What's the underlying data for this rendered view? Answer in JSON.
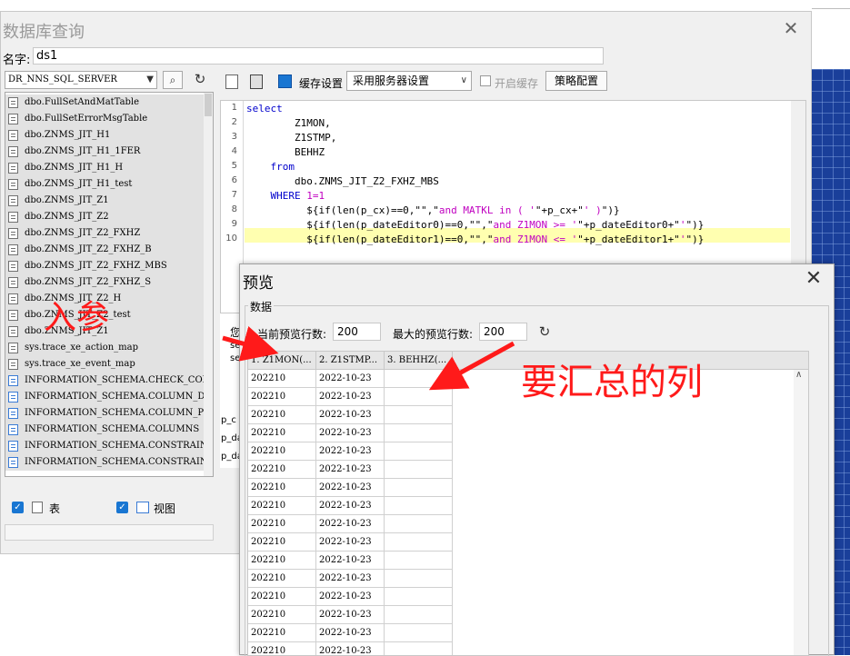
{
  "db_query": {
    "title": "数据库查询",
    "name_label": "名字:",
    "name_value": "ds1",
    "datasource": "DR_NNS_SQL_SERVER",
    "tables": [
      "dbo.FullSetAndMatTable",
      "dbo.FullSetErrorMsgTable",
      "dbo.ZNMS_JIT_H1",
      "dbo.ZNMS_JIT_H1_1FER",
      "dbo.ZNMS_JIT_H1_H",
      "dbo.ZNMS_JIT_H1_test",
      "dbo.ZNMS_JIT_Z1",
      "dbo.ZNMS_JIT_Z2",
      "dbo.ZNMS_JIT_Z2_FXHZ",
      "dbo.ZNMS_JIT_Z2_FXHZ_B",
      "dbo.ZNMS_JIT_Z2_FXHZ_MBS",
      "dbo.ZNMS_JIT_Z2_FXHZ_S",
      "dbo.ZNMS_JIT_Z2_H",
      "dbo.ZNMS_JIT_Z2_test",
      "dbo.ZNMS_JIT_Z1",
      "sys.trace_xe_action_map",
      "sys.trace_xe_event_map",
      "INFORMATION_SCHEMA.CHECK_CONSTRAI",
      "INFORMATION_SCHEMA.COLUMN_DOMAIN_",
      "INFORMATION_SCHEMA.COLUMN_PRIVILE",
      "INFORMATION_SCHEMA.COLUMNS",
      "INFORMATION_SCHEMA.CONSTRAINT_COL",
      "INFORMATION_SCHEMA.CONSTRAINT_TAB"
    ],
    "show_tables_label": "表",
    "show_views_label": "视图",
    "cache_label": "缓存设置",
    "cache_option": "采用服务器设置",
    "enable_cache_label": "开启缓存",
    "strategy_button": "策略配置",
    "sql_lines": [
      "1",
      "2",
      "3",
      "4",
      "5",
      "6",
      "7",
      "8",
      "9",
      "10"
    ],
    "sql": {
      "l1": "select",
      "l2": "        Z1MON,",
      "l3": "        Z1STMP,",
      "l4": "        BEHHZ",
      "l5": "    from",
      "l6": "        dbo.ZNMS_JIT_Z2_FXHZ_MBS",
      "l7a": "    WHERE ",
      "l7b": "1=1",
      "l8a": "          ${if(len(p_cx)==0,\"\",\"",
      "l8b": "and MATKL in ( '",
      "l8c": "\"+p_cx+\"",
      "l8d": "' )",
      "l8e": "\")}",
      "l9a": "          ${if(len(p_dateEditor0)==0,\"\",\"",
      "l9b": "and Z1MON >= '",
      "l9c": "\"+p_dateEditor0+\"",
      "l9d": "'",
      "l9e": "\")}",
      "l10a": "          ${if(len(p_dateEditor1)==0,\"\",\"",
      "l10b": "and Z1MON <= '",
      "l10c": "\"+p_dateEditor1+\"",
      "l10d": "'",
      "l10e": "\")}"
    },
    "params_partial": [
      "p_c",
      "p_da",
      "p_da"
    ],
    "behind_text": [
      "您",
      "se",
      "se"
    ]
  },
  "preview": {
    "title": "预览",
    "group_label": "数据",
    "current_rows_label": "当前预览行数:",
    "current_rows_value": "200",
    "max_rows_label": "最大的预览行数:",
    "max_rows_value": "200",
    "columns": [
      "1. Z1MON(...",
      "2. Z1STMP...",
      "3. BEHHZ(..."
    ],
    "rows": [
      [
        "202210",
        "2022-10-23",
        ""
      ],
      [
        "202210",
        "2022-10-23",
        ""
      ],
      [
        "202210",
        "2022-10-23",
        ""
      ],
      [
        "202210",
        "2022-10-23",
        ""
      ],
      [
        "202210",
        "2022-10-23",
        ""
      ],
      [
        "202210",
        "2022-10-23",
        ""
      ],
      [
        "202210",
        "2022-10-23",
        ""
      ],
      [
        "202210",
        "2022-10-23",
        ""
      ],
      [
        "202210",
        "2022-10-23",
        ""
      ],
      [
        "202210",
        "2022-10-23",
        ""
      ],
      [
        "202210",
        "2022-10-23",
        ""
      ],
      [
        "202210",
        "2022-10-23",
        ""
      ],
      [
        "202210",
        "2022-10-23",
        ""
      ],
      [
        "202210",
        "2022-10-23",
        ""
      ],
      [
        "202210",
        "2022-10-23",
        ""
      ],
      [
        "202210",
        "2022-10-23",
        ""
      ]
    ]
  },
  "annotations": {
    "left_note": "入参",
    "right_note": "要汇总的列",
    "color": "#ff1a1a"
  },
  "icons": {
    "close": "close-icon",
    "refresh": "refresh-icon",
    "table": "table-icon",
    "view": "view-icon"
  }
}
